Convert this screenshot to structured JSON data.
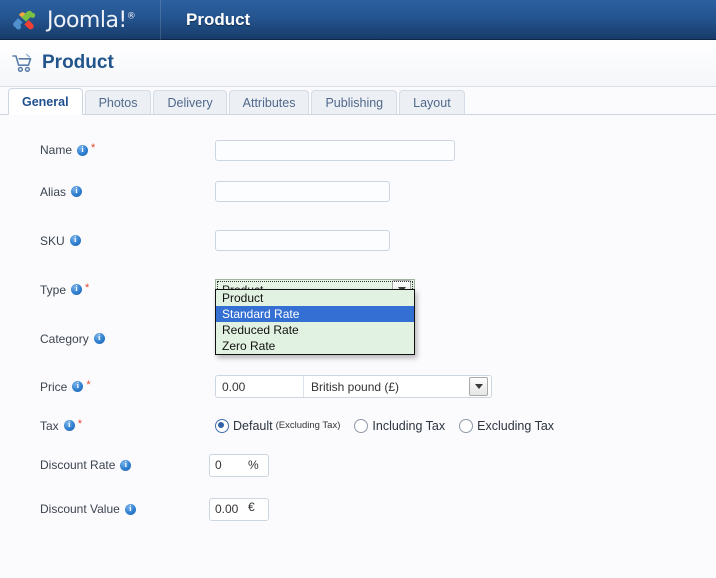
{
  "header": {
    "brand": "Joomla!",
    "brand_icon": "joomla-logo-icon",
    "title": "Product"
  },
  "page": {
    "icon": "shopping-cart-icon",
    "title": "Product"
  },
  "tabs": [
    {
      "label": "General",
      "active": true
    },
    {
      "label": "Photos",
      "active": false
    },
    {
      "label": "Delivery",
      "active": false
    },
    {
      "label": "Attributes",
      "active": false
    },
    {
      "label": "Publishing",
      "active": false
    },
    {
      "label": "Layout",
      "active": false
    }
  ],
  "form": {
    "name": {
      "label": "Name",
      "value": "",
      "required": true,
      "info": true
    },
    "alias": {
      "label": "Alias",
      "value": "",
      "required": false,
      "info": true
    },
    "sku": {
      "label": "SKU",
      "value": "",
      "required": false,
      "info": true
    },
    "type": {
      "label": "Type",
      "value": "Product",
      "required": true,
      "info": true
    },
    "category": {
      "label": "Category",
      "value": "",
      "required": false,
      "info": true
    },
    "price": {
      "label": "Price",
      "value": "0.00",
      "required": true,
      "info": true,
      "currency": "British pound (£)"
    },
    "tax": {
      "label": "Tax",
      "required": true,
      "info": true
    },
    "discount_rate": {
      "label": "Discount Rate",
      "value": "0",
      "unit": "%",
      "info": true
    },
    "discount_value": {
      "label": "Discount Value",
      "value": "0.00",
      "unit": "€",
      "info": true
    }
  },
  "type_dropdown": {
    "open": true,
    "options": [
      {
        "label": "Product",
        "selected": false
      },
      {
        "label": "Standard Rate",
        "selected": true
      },
      {
        "label": "Reduced Rate",
        "selected": false
      },
      {
        "label": "Zero Rate",
        "selected": false
      }
    ]
  },
  "tax_options": [
    {
      "label": "Default",
      "sub": "(Excluding Tax)",
      "selected": true
    },
    {
      "label": "Including Tax",
      "sub": "",
      "selected": false
    },
    {
      "label": "Excluding Tax",
      "sub": "",
      "selected": false
    }
  ],
  "colors": {
    "header_top": "#2c60a0",
    "header_bottom": "#173a68",
    "title_blue": "#22558c",
    "highlight": "#3470d4",
    "dropdown_bg": "#e2f2e2",
    "required_red": "#e8452c"
  }
}
